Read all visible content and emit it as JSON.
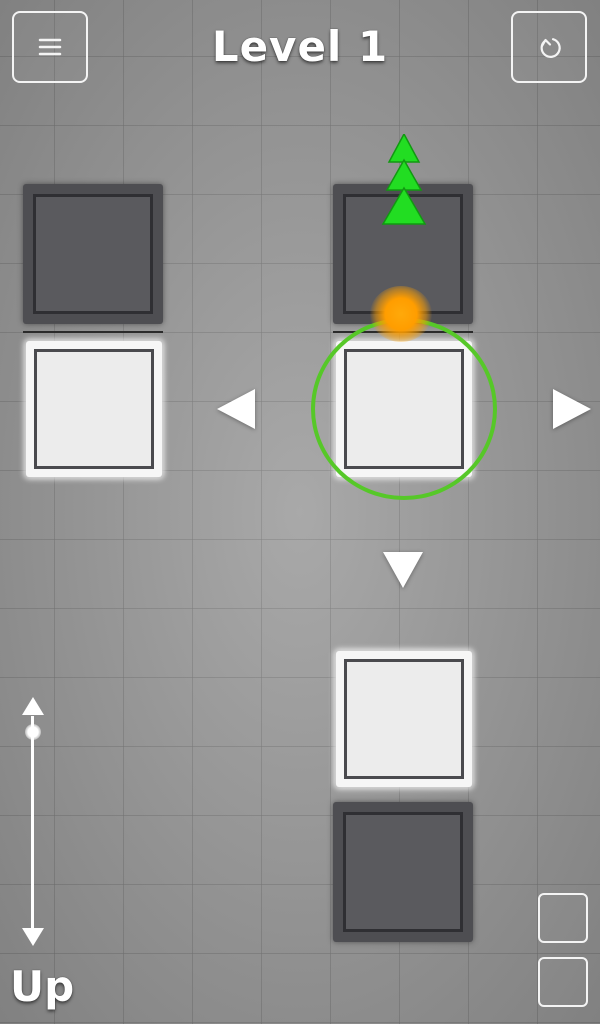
{
  "header": {
    "level_title": "Level 1",
    "menu_icon": "hamburger-menu-icon",
    "restart_icon": "restart-icon"
  },
  "board": {
    "tiles": [
      {
        "name": "tile-top-left",
        "kind": "dark"
      },
      {
        "name": "tile-top-right",
        "kind": "dark"
      },
      {
        "name": "tile-middle-left",
        "kind": "light"
      },
      {
        "name": "tile-middle-right",
        "kind": "light"
      },
      {
        "name": "tile-lower-right",
        "kind": "light"
      },
      {
        "name": "tile-bottom-right",
        "kind": "dark"
      }
    ],
    "move_arrows": [
      "left",
      "right",
      "down"
    ],
    "goal_icon": "green-tree-icon",
    "player_icon": "orange-glow-ball",
    "colors": {
      "selection_ring": "#56c828",
      "player": "#ff9d00",
      "goal": "#22dd22",
      "dark_tile": "#4e4e52",
      "light_tile": "#f6f6f6"
    }
  },
  "controls": {
    "direction_label": "Up",
    "slider_arrows": [
      "up",
      "down"
    ],
    "side_buttons": 2
  }
}
